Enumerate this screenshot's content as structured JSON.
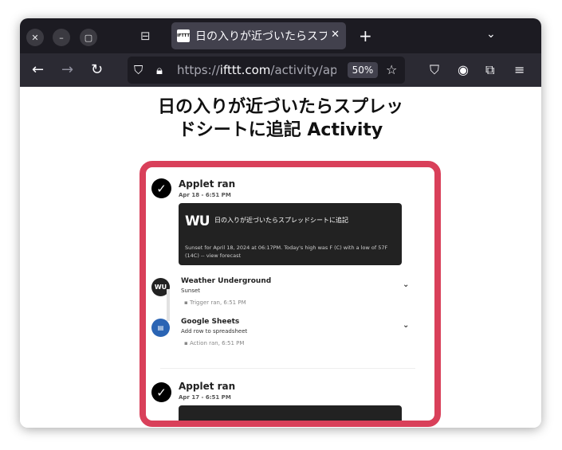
{
  "browser": {
    "tab_title": "日の入りが近づいたらスプレッドシートに追記 Activity",
    "favicon_text": "IFTTT",
    "url_protocol": "https://",
    "url_main": "ifttt.com",
    "url_path": "/activity/applet",
    "zoom": "50%"
  },
  "page": {
    "title_line1": "日の入りが近づいたらスプレッ",
    "title_line2": "ドシートに追記 Activity"
  },
  "activity": [
    {
      "status": "Applet ran",
      "date": "Apr 18 - 6:51 PM",
      "card_logo": "wu",
      "card_title": "日の入りが近づいたらスプレッドシートに追記",
      "card_desc": "Sunset for April 18, 2024 at 06:17PM. Today's high was F (C) with a low of 57F (14C) -- view forecast",
      "services": [
        {
          "name": "Weather Underground",
          "sub": "Sunset",
          "meta": "Trigger ran, 6:51 PM",
          "icon": "wu"
        },
        {
          "name": "Google Sheets",
          "sub": "Add row to spreadsheet",
          "meta": "Action ran, 6:51 PM",
          "icon": "sheet"
        }
      ]
    },
    {
      "status": "Applet ran",
      "date": "Apr 17 - 6:51 PM"
    }
  ],
  "colors": {
    "highlight": "#d9405a",
    "card_bg": "#222222",
    "sheets_blue": "#2a64b4"
  }
}
